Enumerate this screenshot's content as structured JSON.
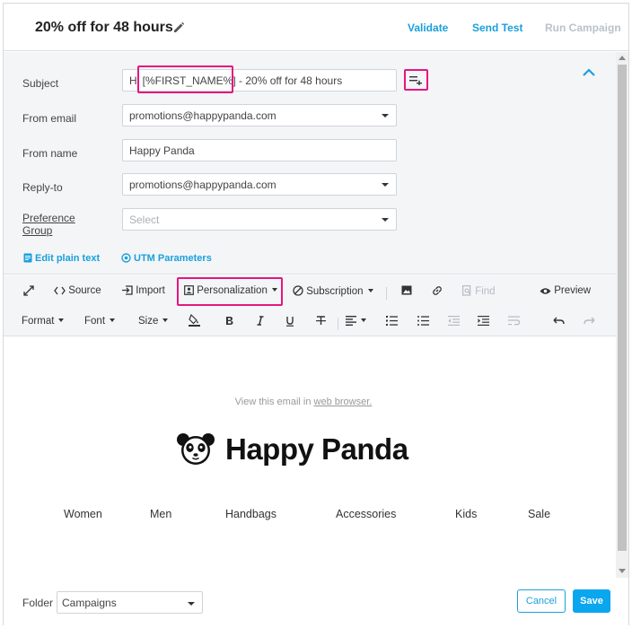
{
  "header": {
    "title": "20% off for 48 hours",
    "validate_label": "Validate",
    "send_test_label": "Send Test",
    "run_campaign_label": "Run Campaign"
  },
  "form": {
    "subject_label": "Subject",
    "subject_value": "Hi [%FIRST_NAME%] - 20% off for 48 hours",
    "from_email_label": "From email",
    "from_email_value": "promotions@happypanda.com",
    "from_name_label": "From name",
    "from_name_value": "Happy Panda",
    "reply_to_label": "Reply-to",
    "reply_to_value": "promotions@happypanda.com",
    "preference_group_label_1": "Preference",
    "preference_group_label_2": "Group",
    "preference_group_placeholder": "Select",
    "edit_plain_text_label": "Edit plain text",
    "utm_parameters_label": "UTM Parameters"
  },
  "toolbar": {
    "source_label": "Source",
    "import_label": "Import",
    "personalization_label": "Personalization",
    "subscription_label": "Subscription",
    "find_label": "Find",
    "preview_label": "Preview",
    "format_label": "Format",
    "font_label": "Font",
    "size_label": "Size"
  },
  "canvas": {
    "view_prefix": "View this email in ",
    "view_link": "web browser.",
    "brand_name": "Happy Panda",
    "nav": [
      "Women",
      "Men",
      "Handbags",
      "Accessories",
      "Kids",
      "Sale"
    ]
  },
  "footer": {
    "folder_label": "Folder",
    "folder_value": "Campaigns",
    "cancel_label": "Cancel",
    "save_label": "Save"
  },
  "colors": {
    "accent": "#1aa0dc",
    "highlight": "#e6167f",
    "save_bg": "#0aa6ee"
  }
}
